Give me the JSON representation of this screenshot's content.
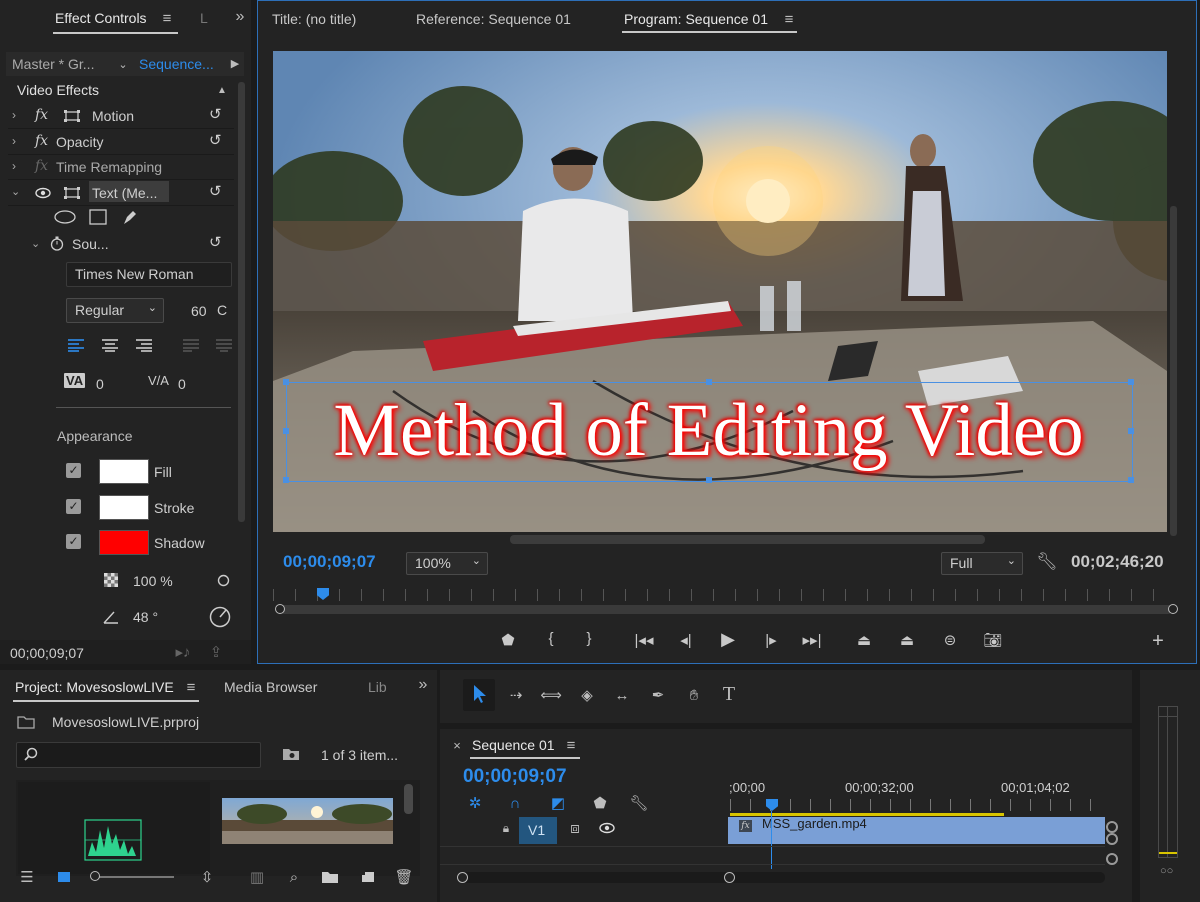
{
  "effect_controls": {
    "tab_label": "Effect Controls",
    "tab_trunc": "L",
    "master_label": "Master * Gr...",
    "sequence_label": "Sequence...",
    "video_effects_label": "Video Effects",
    "effects": [
      {
        "name": "Motion"
      },
      {
        "name": "Opacity"
      },
      {
        "name": "Time Remapping"
      },
      {
        "name": "Text (Me..."
      }
    ],
    "source_label": "Sou...",
    "font_name": "Times New Roman",
    "font_style": "Regular",
    "font_size": "60",
    "kerning_value": "0",
    "tracking_value": "0",
    "appearance_label": "Appearance",
    "fill_label": "Fill",
    "stroke_label": "Stroke",
    "shadow_label": "Shadow",
    "fill_color": "#ffffff",
    "stroke_color": "#ffffff",
    "shadow_color": "#ff0000",
    "opacity_value": "100 %",
    "angle_value": "48 °",
    "timecode": "00;00;09;07"
  },
  "program_monitor": {
    "tabs": [
      "Title: (no title)",
      "Reference: Sequence 01",
      "Program: Sequence 01"
    ],
    "title_text": "Method of Editing Video",
    "current_timecode": "00;00;09;07",
    "zoom": "100%",
    "quality": "Full",
    "duration": "00;02;46;20"
  },
  "project": {
    "tab_label": "Project: MovesoslowLIVE",
    "media_browser": "Media Browser",
    "lib_label": "Lib",
    "file_name": "MovesoslowLIVE.prproj",
    "item_count": "1 of 3 item..."
  },
  "timeline": {
    "tab_label": "Sequence 01",
    "timecode": "00;00;09;07",
    "ruler": [
      ";00;00",
      "00;00;32;00",
      "00;01;04;02"
    ],
    "track_label": "V1",
    "clip_name": "MSS_garden.mp4",
    "clip_fx": "fx"
  },
  "colors": {
    "accent": "#2d8ceb",
    "panel": "#232323",
    "clip": "#7a9fd6"
  }
}
